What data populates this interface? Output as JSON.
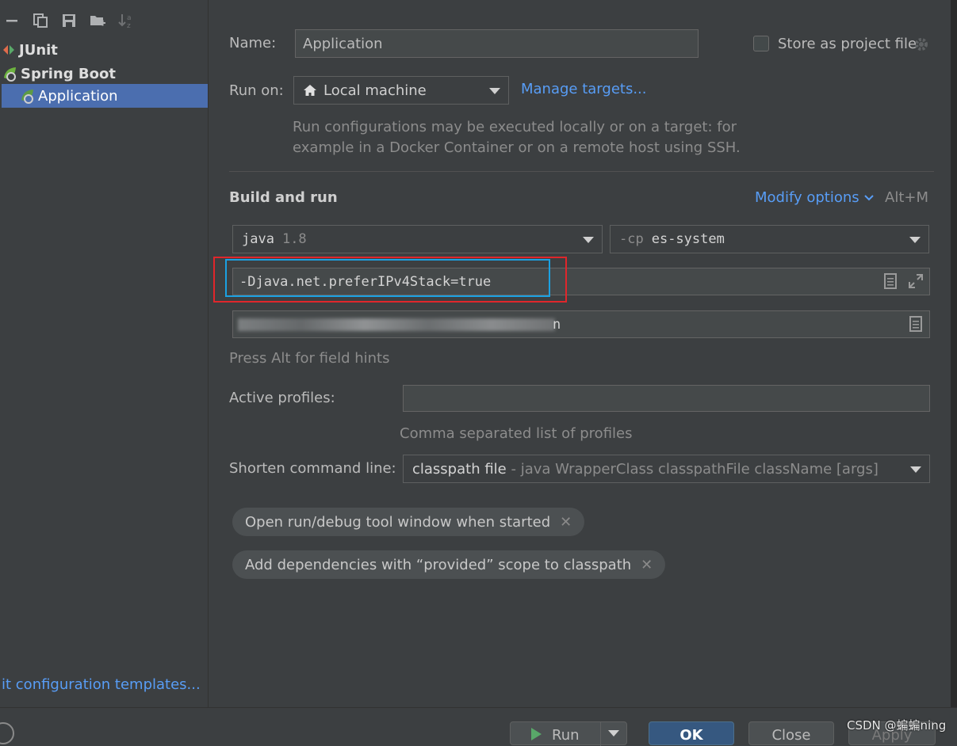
{
  "left": {
    "tree": [
      {
        "label": "JUnit",
        "icon": "junit-icon"
      },
      {
        "label": "Spring Boot",
        "icon": "spring-boot-icon"
      },
      {
        "label": "Application",
        "icon": "spring-app-icon",
        "selected": true
      }
    ],
    "edit_templates_link": "it configuration templates..."
  },
  "form": {
    "name_label": "Name:",
    "name_value": "Application",
    "store_label": "Store as project file",
    "store_checked": false,
    "run_on_label": "Run on:",
    "run_on_value": "Local machine",
    "manage_targets": "Manage targets...",
    "run_on_hint_1": "Run configurations may be executed locally or on a target: for",
    "run_on_hint_2": "example in a Docker Container or on a remote host using SSH.",
    "section_title": "Build and run",
    "modify_options": "Modify options",
    "modify_shortcut": "Alt+M",
    "jre_main": "java",
    "jre_version": "1.8",
    "cp_prefix": "-cp",
    "cp_module": "es-system",
    "vm_options": "-Djava.net.preferIPv4Stack=true",
    "main_class_tail": "n",
    "field_hint": "Press Alt for field hints",
    "active_profiles_label": "Active profiles:",
    "active_profiles_value": "",
    "profiles_hint": "Comma separated list of profiles",
    "shorten_label": "Shorten command line:",
    "shorten_value": "classpath file",
    "shorten_desc": " - java WrapperClass classpathFile className [args]",
    "chips": [
      "Open run/debug tool window when started",
      "Add dependencies with “provided” scope to classpath"
    ]
  },
  "buttons": {
    "run": "Run",
    "ok": "OK",
    "close": "Close",
    "apply": "Apply"
  },
  "watermark": "CSDN @蝙蝙ning",
  "colors": {
    "background": "#3c3f41",
    "selection": "#4b6eaf",
    "link": "#589df6",
    "highlight_red": "#e0262b",
    "highlight_blue": "#1ba1e2"
  }
}
